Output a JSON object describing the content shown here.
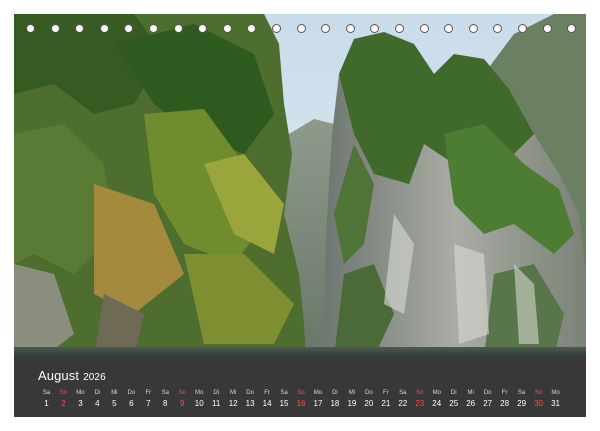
{
  "calendar": {
    "month": "August",
    "year": "2026",
    "days": [
      {
        "dow": "Sa",
        "num": "1"
      },
      {
        "dow": "So",
        "num": "2"
      },
      {
        "dow": "Mo",
        "num": "3"
      },
      {
        "dow": "Di",
        "num": "4"
      },
      {
        "dow": "Mi",
        "num": "5"
      },
      {
        "dow": "Do",
        "num": "6"
      },
      {
        "dow": "Fr",
        "num": "7"
      },
      {
        "dow": "Sa",
        "num": "8"
      },
      {
        "dow": "So",
        "num": "9"
      },
      {
        "dow": "Mo",
        "num": "10"
      },
      {
        "dow": "Di",
        "num": "11"
      },
      {
        "dow": "Mi",
        "num": "12"
      },
      {
        "dow": "Do",
        "num": "13"
      },
      {
        "dow": "Fr",
        "num": "14"
      },
      {
        "dow": "Sa",
        "num": "15"
      },
      {
        "dow": "So",
        "num": "16"
      },
      {
        "dow": "Mo",
        "num": "17"
      },
      {
        "dow": "Di",
        "num": "18"
      },
      {
        "dow": "Mi",
        "num": "19"
      },
      {
        "dow": "Do",
        "num": "20"
      },
      {
        "dow": "Fr",
        "num": "21"
      },
      {
        "dow": "Sa",
        "num": "22"
      },
      {
        "dow": "So",
        "num": "23"
      },
      {
        "dow": "Mo",
        "num": "24"
      },
      {
        "dow": "Di",
        "num": "25"
      },
      {
        "dow": "Mi",
        "num": "26"
      },
      {
        "dow": "Do",
        "num": "27"
      },
      {
        "dow": "Fr",
        "num": "28"
      },
      {
        "dow": "Sa",
        "num": "29"
      },
      {
        "dow": "So",
        "num": "30"
      },
      {
        "dow": "Mo",
        "num": "31"
      }
    ]
  },
  "colors": {
    "sunday": "#ff4a4a",
    "panel": "#383838",
    "text": "#ffffff"
  }
}
